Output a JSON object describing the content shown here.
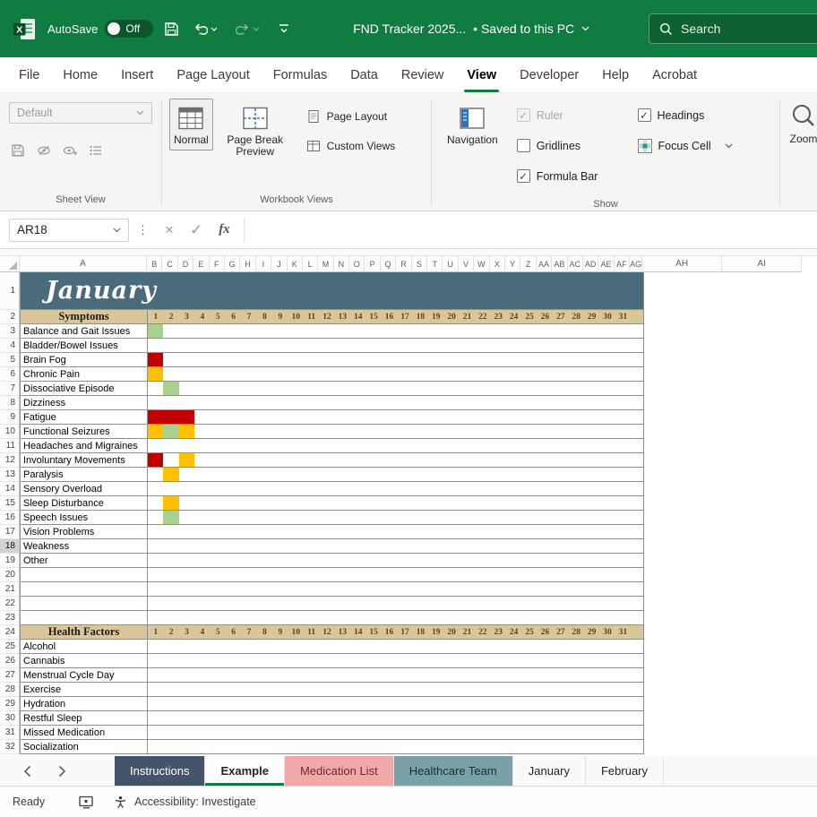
{
  "colors": {
    "title_green": "#107C41",
    "accent_green": "#107C41",
    "banner": "#4A6B7C",
    "section_header_bg": "#D9C69B",
    "fill_red": "#C00000",
    "fill_yellow": "#FFC000",
    "fill_green": "#A9D08E",
    "tab_instructions_bg": "#44546A",
    "tab_medication_bg": "#F1A8A8",
    "tab_healthcare_bg": "#7AA0A8"
  },
  "titlebar": {
    "autosave_label": "AutoSave",
    "autosave_state": "Off",
    "doc_title": "FND Tracker 2025...",
    "save_status": "• Saved to this PC",
    "search_placeholder": "Search"
  },
  "ribbon_tabs": [
    "File",
    "Home",
    "Insert",
    "Page Layout",
    "Formulas",
    "Data",
    "Review",
    "View",
    "Developer",
    "Help",
    "Acrobat"
  ],
  "active_tab": "View",
  "ribbon": {
    "sheet_view": {
      "combo_value": "Default",
      "label": "Sheet View"
    },
    "workbook_views": {
      "normal": "Normal",
      "page_break_preview": "Page Break Preview",
      "page_layout": "Page Layout",
      "custom_views": "Custom Views",
      "selected": "Normal",
      "label": "Workbook Views"
    },
    "show": {
      "navigation": "Navigation",
      "checkboxes": [
        {
          "label": "Ruler",
          "checked": true,
          "disabled": true
        },
        {
          "label": "Gridlines",
          "checked": false,
          "disabled": false
        },
        {
          "label": "Formula Bar",
          "checked": true,
          "disabled": false
        },
        {
          "label": "Headings",
          "checked": true,
          "disabled": false
        }
      ],
      "focus_cell": "Focus Cell",
      "label": "Show"
    },
    "zoom": {
      "label": "Zoom"
    }
  },
  "formula_bar": {
    "name_box": "AR18",
    "fx_label": "fx",
    "formula_value": ""
  },
  "sheet": {
    "month_title": "January",
    "active_cell_row": 18,
    "visible_columns": [
      "A",
      "B",
      "C",
      "D",
      "E",
      "F",
      "G",
      "H",
      "I",
      "J",
      "K",
      "L",
      "M",
      "N",
      "O",
      "P",
      "Q",
      "R",
      "S",
      "T",
      "U",
      "V",
      "W",
      "X",
      "Y",
      "Z",
      "AA",
      "AB",
      "AC",
      "AD",
      "AE",
      "AF",
      "AG",
      "AH",
      "AI"
    ],
    "days": [
      1,
      2,
      3,
      4,
      5,
      6,
      7,
      8,
      9,
      10,
      11,
      12,
      13,
      14,
      15,
      16,
      17,
      18,
      19,
      20,
      21,
      22,
      23,
      24,
      25,
      26,
      27,
      28,
      29,
      30,
      31
    ],
    "symptoms_section": {
      "header": "Symptoms",
      "header_row": 2,
      "rows": [
        {
          "row": 3,
          "label": "Balance and Gait Issues",
          "fills": {
            "1": "green"
          }
        },
        {
          "row": 4,
          "label": "Bladder/Bowel Issues",
          "fills": {}
        },
        {
          "row": 5,
          "label": "Brain Fog",
          "fills": {
            "1": "red"
          }
        },
        {
          "row": 6,
          "label": "Chronic Pain",
          "fills": {
            "1": "yellow"
          }
        },
        {
          "row": 7,
          "label": "Dissociative Episode",
          "fills": {
            "2": "green"
          }
        },
        {
          "row": 8,
          "label": "Dizziness",
          "fills": {}
        },
        {
          "row": 9,
          "label": "Fatigue",
          "fills": {
            "1": "red",
            "2": "red",
            "3": "red"
          }
        },
        {
          "row": 10,
          "label": "Functional Seizures",
          "fills": {
            "1": "yellow",
            "2": "green",
            "3": "yellow"
          }
        },
        {
          "row": 11,
          "label": "Headaches and Migraines",
          "fills": {}
        },
        {
          "row": 12,
          "label": "Involuntary Movements",
          "fills": {
            "1": "red",
            "3": "yellow"
          }
        },
        {
          "row": 13,
          "label": "Paralysis",
          "fills": {
            "2": "yellow"
          }
        },
        {
          "row": 14,
          "label": "Sensory Overload",
          "fills": {}
        },
        {
          "row": 15,
          "label": "Sleep Disturbance",
          "fills": {
            "2": "yellow"
          }
        },
        {
          "row": 16,
          "label": "Speech Issues",
          "fills": {
            "2": "green"
          }
        },
        {
          "row": 17,
          "label": "Vision Problems",
          "fills": {}
        },
        {
          "row": 18,
          "label": "Weakness",
          "fills": {}
        },
        {
          "row": 19,
          "label": "Other",
          "fills": {}
        }
      ]
    },
    "empty_rows": [
      20,
      21,
      22,
      23
    ],
    "health_section": {
      "header": "Health Factors",
      "header_row": 24,
      "rows": [
        {
          "row": 25,
          "label": "Alcohol"
        },
        {
          "row": 26,
          "label": "Cannabis"
        },
        {
          "row": 27,
          "label": "Menstrual Cycle Day"
        },
        {
          "row": 28,
          "label": "Exercise"
        },
        {
          "row": 29,
          "label": "Hydration"
        },
        {
          "row": 30,
          "label": "Restful Sleep"
        },
        {
          "row": 31,
          "label": "Missed Medication"
        },
        {
          "row": 32,
          "label": "Socialization"
        }
      ]
    }
  },
  "sheet_tabs": {
    "tabs": [
      {
        "label": "Instructions",
        "style": "dark"
      },
      {
        "label": "Example",
        "style": "active"
      },
      {
        "label": "Medication List",
        "style": "pink"
      },
      {
        "label": "Healthcare Team",
        "style": "teal"
      },
      {
        "label": "January",
        "style": "plain"
      },
      {
        "label": "February",
        "style": "plain"
      }
    ]
  },
  "status_bar": {
    "mode": "Ready",
    "accessibility": "Accessibility: Investigate"
  }
}
